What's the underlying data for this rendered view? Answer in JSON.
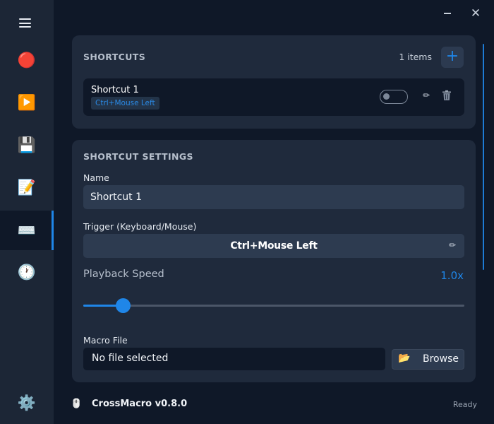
{
  "window": {
    "minimize_icon": "minimize-icon",
    "close_glyph": "✕"
  },
  "sidebar": {
    "menu_icon": "hamburger-icon",
    "items": [
      {
        "name": "record",
        "icon": "🔴",
        "icon_name": "record-icon",
        "active": false
      },
      {
        "name": "playback",
        "icon": "▶️",
        "icon_name": "play-icon",
        "active": false
      },
      {
        "name": "files",
        "icon": "💾",
        "icon_name": "floppy-disk-icon",
        "active": false
      },
      {
        "name": "editor",
        "icon": "📝",
        "icon_name": "memo-icon",
        "active": false
      },
      {
        "name": "shortcuts",
        "icon": "⌨️",
        "icon_name": "keyboard-icon",
        "active": true
      },
      {
        "name": "schedule",
        "icon": "🕐",
        "icon_name": "clock-icon",
        "active": false
      }
    ],
    "settings_icon": "⚙️"
  },
  "shortcuts_card": {
    "title": "SHORTCUTS",
    "count_label": "1 items",
    "add_label": "+",
    "items": [
      {
        "name": "Shortcut 1",
        "trigger": "Ctrl+Mouse Left",
        "enabled": false,
        "edit_glyph": "✏",
        "delete_icon": "trash-icon"
      }
    ]
  },
  "settings_card": {
    "title": "SHORTCUT SETTINGS",
    "name_label": "Name",
    "name_value": "Shortcut 1",
    "trigger_label": "Trigger (Keyboard/Mouse)",
    "trigger_value": "Ctrl+Mouse Left",
    "trigger_edit_glyph": "✏",
    "speed_label": "Playback Speed",
    "speed_value": "1.0x",
    "speed_fraction": 0.105,
    "macro_label": "Macro File",
    "macro_value": "No file selected",
    "browse_icon": "📂",
    "browse_label": "Browse"
  },
  "footer": {
    "icon": "🖱️",
    "app_name": "CrossMacro v0.8.0",
    "status": "Ready"
  },
  "colors": {
    "accent": "#1f86e8",
    "background": "#0f1828",
    "card": "#1f2a3c",
    "sidebar": "#1c2636"
  }
}
